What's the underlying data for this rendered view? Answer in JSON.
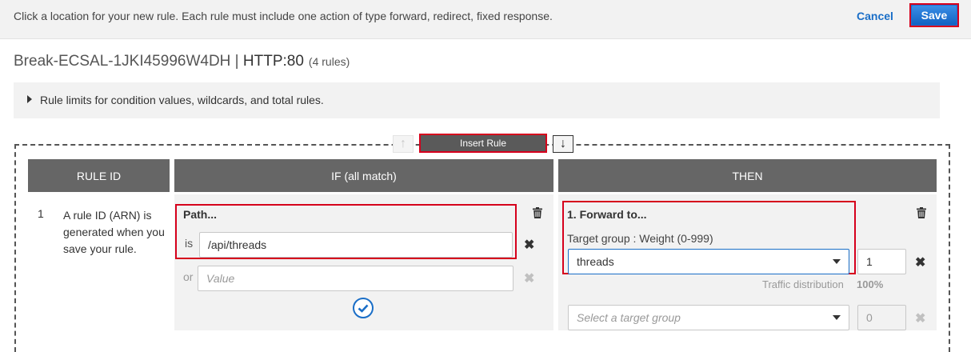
{
  "topbar": {
    "message": "Click a location for your new rule. Each rule must include one action of type forward, redirect, fixed response.",
    "cancel_label": "Cancel",
    "save_label": "Save"
  },
  "header": {
    "name": "Break-ECSAL-1JKI45996W4DH",
    "separator": " | ",
    "protocol": "HTTP:80",
    "rule_count": "(4 rules)"
  },
  "limits": {
    "label": "Rule limits for condition values, wildcards, and total rules."
  },
  "insert": {
    "up_glyph": "↑",
    "label": "Insert Rule",
    "down_glyph": "↓"
  },
  "columns": {
    "rule_id": "RULE ID",
    "if": "IF (all match)",
    "then": "THEN"
  },
  "rule": {
    "number": "1",
    "id_text": "A rule ID (ARN) is generated when you save your rule."
  },
  "condition": {
    "title": "Path...",
    "is_label": "is",
    "value": "/api/threads",
    "or_label": "or",
    "or_placeholder": "Value"
  },
  "action": {
    "title": "1. Forward to...",
    "target_label": "Target group : Weight (0-999)",
    "target_value": "threads",
    "weight_value": "1",
    "distribution_label": "Traffic distribution",
    "distribution_value": "100%",
    "select_placeholder": "Select a target group",
    "second_weight": "0"
  },
  "colors": {
    "accent": "#1a6ec7",
    "highlight": "#d6001c",
    "header_bg": "#666666"
  }
}
